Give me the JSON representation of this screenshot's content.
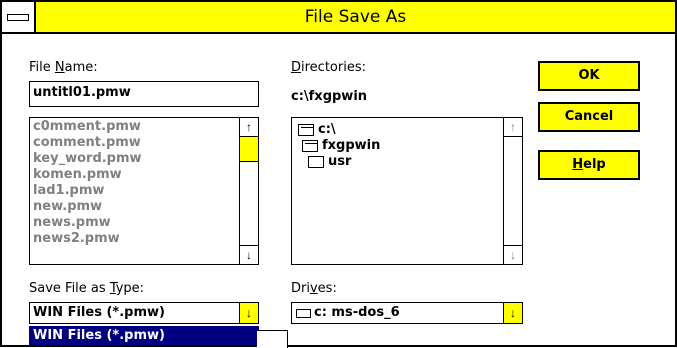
{
  "window": {
    "title": "File Save As"
  },
  "file_name": {
    "label_prefix": "File ",
    "label_accel": "N",
    "label_suffix": "ame:",
    "value": "untitl01.pmw",
    "files": [
      "c0mment.pmw",
      "comment.pmw",
      "key_word.pmw",
      "komen.pmw",
      "lad1.pmw",
      "new.pmw",
      "news.pmw",
      "news2.pmw"
    ]
  },
  "directories": {
    "label_accel": "D",
    "label_suffix": "irectories:",
    "current_path": "c:\\fxgpwin",
    "items": [
      {
        "name": "c:\\",
        "open": true
      },
      {
        "name": "fxgpwin",
        "open": true
      },
      {
        "name": "usr",
        "open": false
      }
    ]
  },
  "save_type": {
    "label_prefix": "Save File as ",
    "label_accel": "T",
    "label_suffix": "ype:",
    "value": "WIN Files (*.pmw)",
    "highlighted_option": "WIN Files (*.pmw)"
  },
  "drives": {
    "label_prefix": "Dri",
    "label_accel": "v",
    "label_suffix": "es:",
    "value": "c: ms-dos_6"
  },
  "buttons": {
    "ok": "OK",
    "cancel": "Cancel",
    "help_accel": "H",
    "help_suffix": "elp"
  },
  "scroll_glyphs": {
    "up": "↑",
    "down": "↓"
  },
  "colors": {
    "accent": "#ffff00",
    "selection": "#000080"
  }
}
